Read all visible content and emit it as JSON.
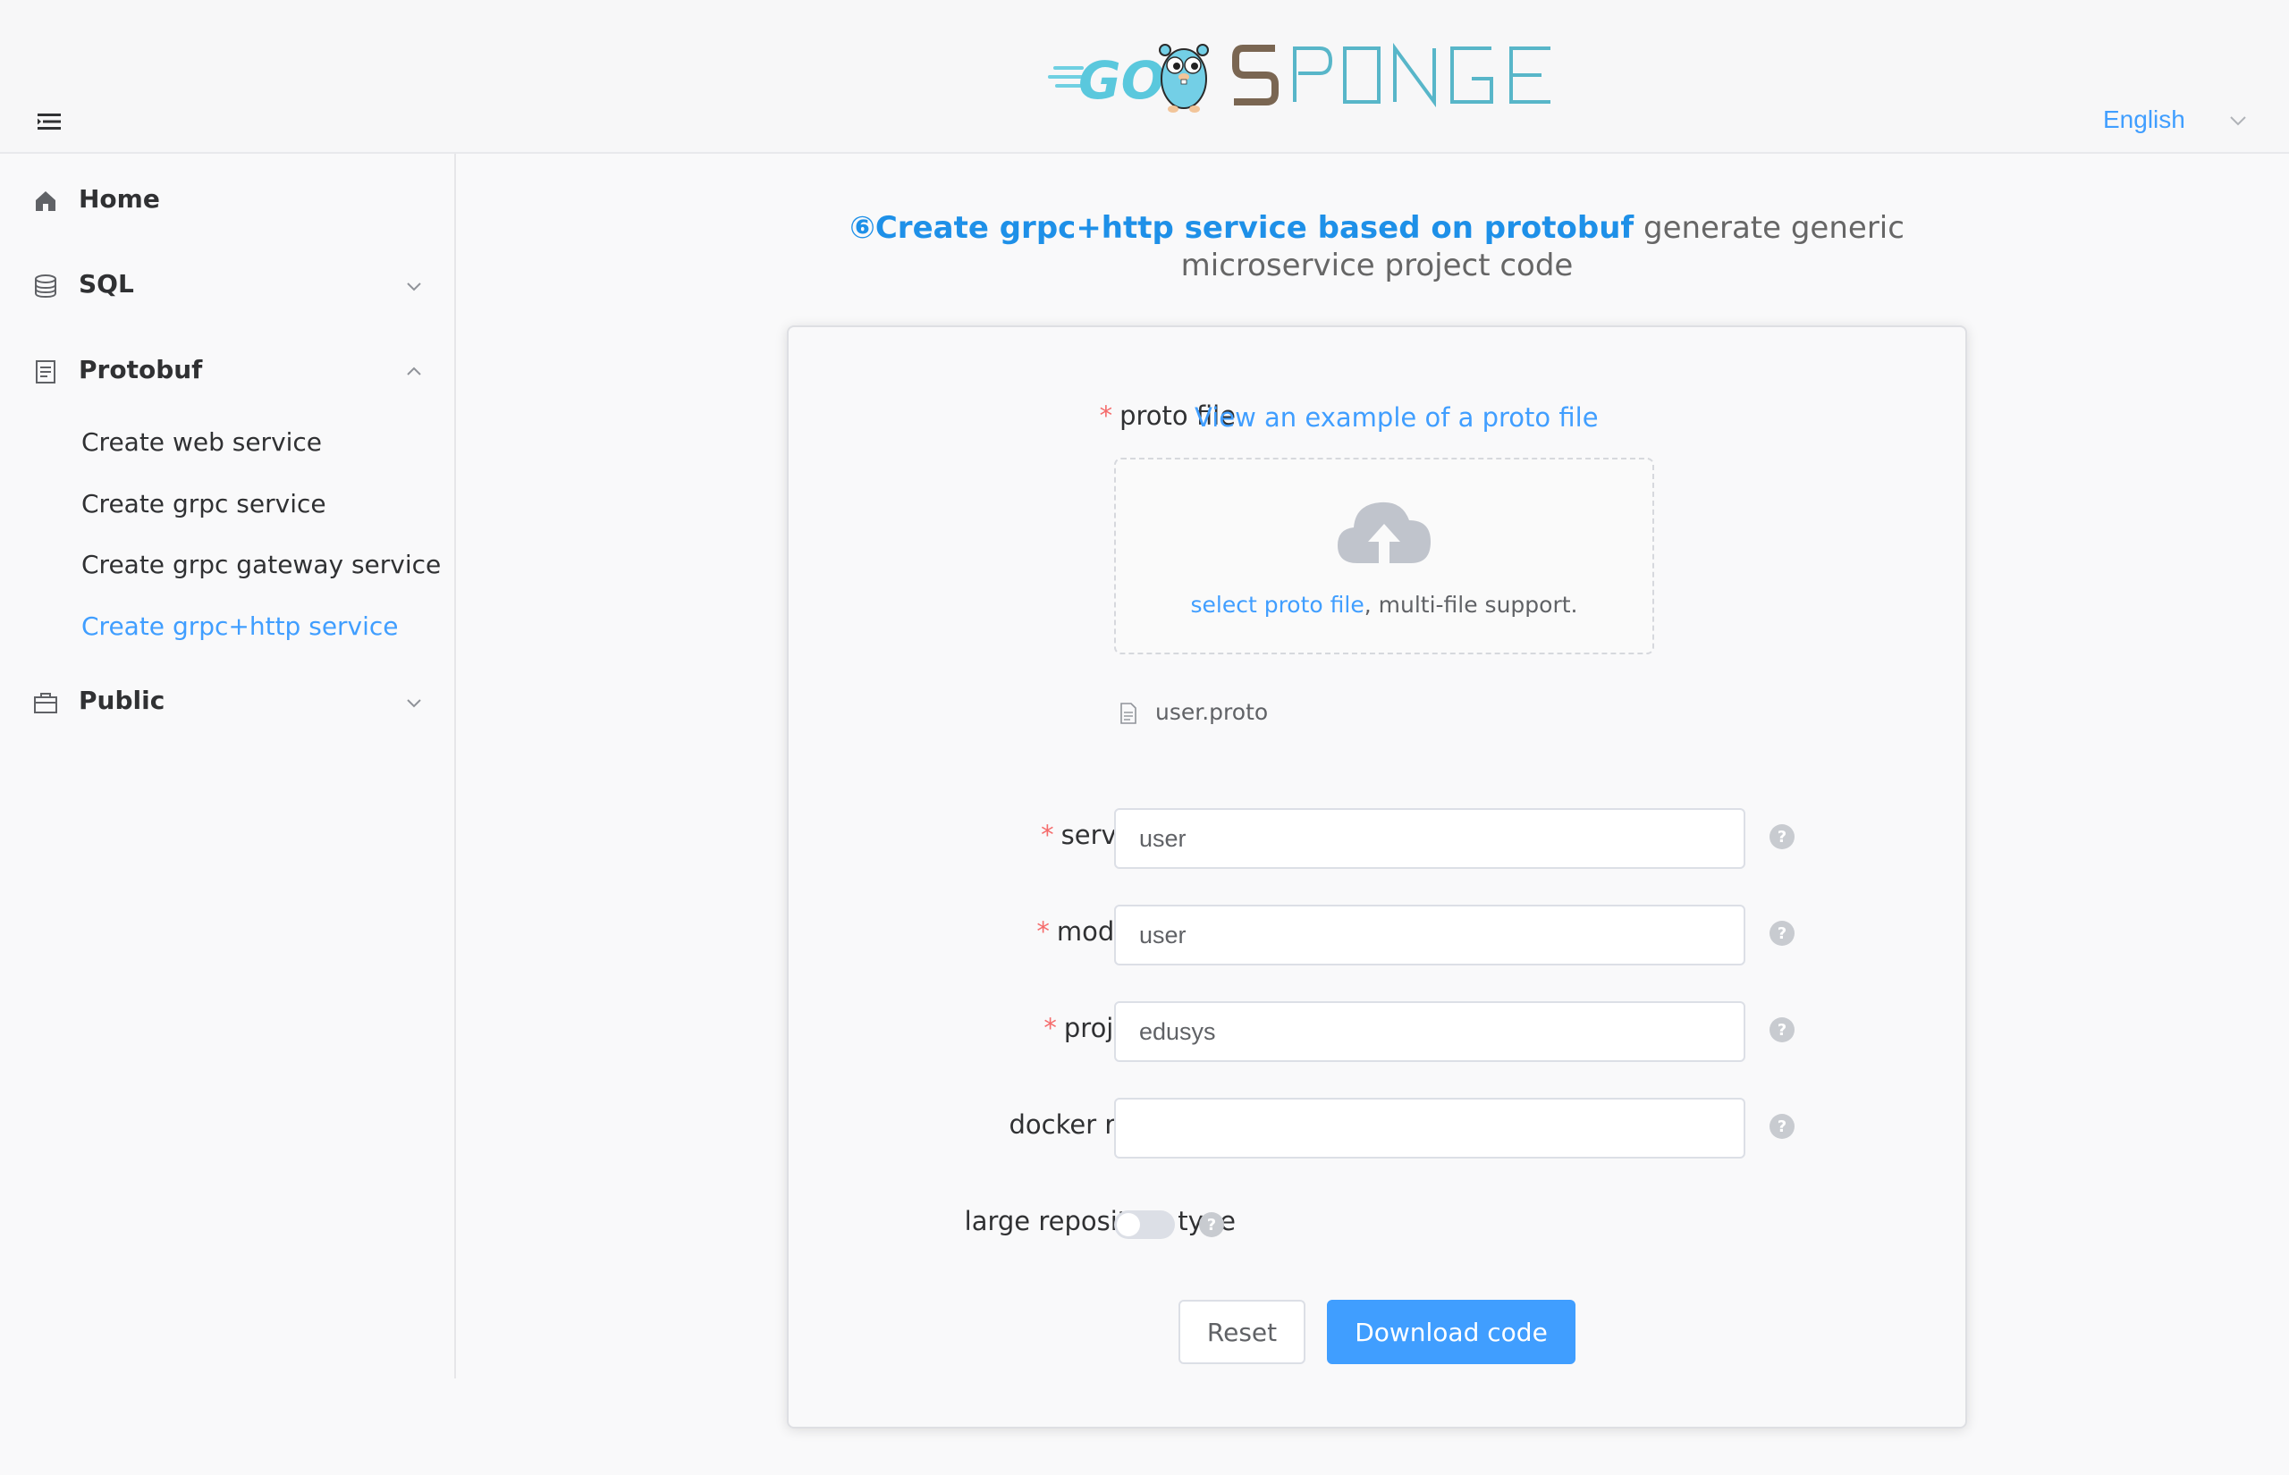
{
  "header": {
    "logo_text": "GO SPONGE",
    "language": "English"
  },
  "sidebar": {
    "items": [
      {
        "label": "Home",
        "icon": "home-icon"
      },
      {
        "label": "SQL",
        "icon": "database-icon",
        "expanded": false
      },
      {
        "label": "Protobuf",
        "icon": "document-icon",
        "expanded": true,
        "children": [
          {
            "label": "Create web service",
            "active": false
          },
          {
            "label": "Create grpc service",
            "active": false
          },
          {
            "label": "Create grpc gateway service",
            "active": false
          },
          {
            "label": "Create grpc+http service",
            "active": true
          }
        ]
      },
      {
        "label": "Public",
        "icon": "briefcase-icon",
        "expanded": false
      }
    ]
  },
  "main": {
    "title_accent": "⑥Create grpc+http service based on protobuf",
    "title_rest": " generate generic microservice project code"
  },
  "form": {
    "proto_file": {
      "label": "proto file",
      "example_link": "View an example of a proto file",
      "upload_link": "select proto file",
      "upload_hint": ", multi-file support.",
      "uploaded_file": "user.proto"
    },
    "service_name": {
      "label": "service name",
      "value": "user"
    },
    "module_name": {
      "label": "module name",
      "value": "user"
    },
    "project_name": {
      "label": "project name",
      "value": "edusys"
    },
    "docker_repository": {
      "label": "docker repository",
      "value": ""
    },
    "large_repository_type": {
      "label": "large repository type",
      "enabled": false
    },
    "buttons": {
      "reset": "Reset",
      "download": "Download code"
    }
  },
  "colors": {
    "accent": "#409eff",
    "title_accent": "#1e90e8",
    "required": "#f56c6c"
  }
}
